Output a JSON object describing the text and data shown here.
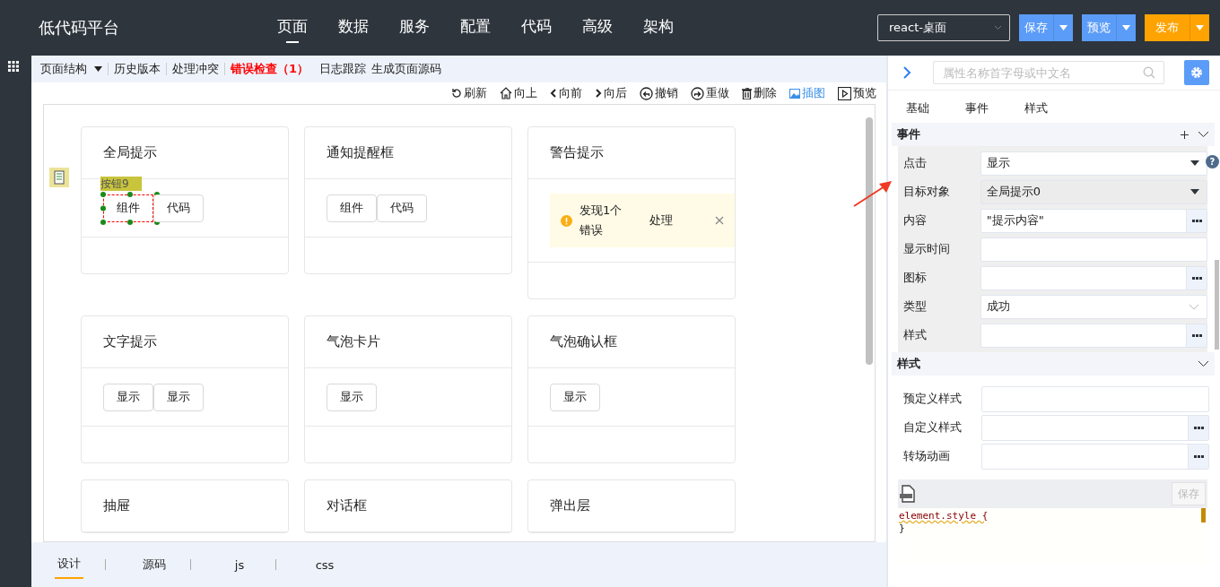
{
  "header": {
    "logo": "低代码平台",
    "nav": [
      {
        "label": "页面",
        "selected": true
      },
      {
        "label": "数据",
        "selected": false
      },
      {
        "label": "服务",
        "selected": false
      },
      {
        "label": "配置",
        "selected": false
      },
      {
        "label": "代码",
        "selected": false
      },
      {
        "label": "高级",
        "selected": false
      },
      {
        "label": "架构",
        "selected": false
      }
    ],
    "env_select": {
      "value": "react-桌面"
    },
    "buttons": [
      {
        "label": "保存",
        "kind": "primary"
      },
      {
        "label": "预览",
        "kind": "primary"
      },
      {
        "label": "发布",
        "kind": "warning"
      }
    ]
  },
  "subtoolbar": [
    {
      "label": "页面结构",
      "kind": "dropdown"
    },
    {
      "label": "历史版本",
      "kind": "plain"
    },
    {
      "label": "处理冲突",
      "kind": "plain"
    },
    {
      "label": "错误检查（1）",
      "kind": "error"
    },
    {
      "label": "日志跟踪",
      "kind": "plain"
    },
    {
      "label": "生成页面源码",
      "kind": "plain"
    }
  ],
  "actions": [
    {
      "label": "刷新",
      "selected": false
    },
    {
      "label": "向上",
      "selected": false
    },
    {
      "label": "向前",
      "selected": false
    },
    {
      "label": "向后",
      "selected": false
    },
    {
      "label": "撤销",
      "selected": false
    },
    {
      "label": "重做",
      "selected": false
    },
    {
      "label": "删除",
      "selected": false
    },
    {
      "label": "插图",
      "selected": true
    },
    {
      "label": "预览",
      "selected": false
    }
  ],
  "cards": [
    {
      "title": "全局提示",
      "kind": "buttons",
      "buttons": [
        {
          "label": "组件",
          "selected": true,
          "tag": "按钮9"
        },
        {
          "label": "代码",
          "selected": false
        }
      ]
    },
    {
      "title": "通知提醒框",
      "kind": "buttons",
      "buttons": [
        {
          "label": "组件",
          "selected": false
        },
        {
          "label": "代码",
          "selected": false
        }
      ]
    },
    {
      "title": "警告提示",
      "kind": "alert",
      "alert": {
        "text": "发现1个错误",
        "action": "处理"
      }
    },
    {
      "title": "文字提示",
      "kind": "buttons",
      "buttons": [
        {
          "label": "显示",
          "selected": false
        },
        {
          "label": "显示",
          "selected": false
        }
      ]
    },
    {
      "title": "气泡卡片",
      "kind": "buttons",
      "buttons": [
        {
          "label": "显示",
          "selected": false
        }
      ]
    },
    {
      "title": "气泡确认框",
      "kind": "buttons",
      "buttons": [
        {
          "label": "显示",
          "selected": false
        }
      ]
    },
    {
      "title": "抽屉",
      "kind": "cut"
    },
    {
      "title": "对话框",
      "kind": "cut"
    },
    {
      "title": "弹出层",
      "kind": "cut"
    }
  ],
  "bottom_tabs": [
    {
      "label": "设计",
      "selected": true
    },
    {
      "label": "源码",
      "selected": false
    },
    {
      "label": "js",
      "selected": false
    },
    {
      "label": "css",
      "selected": false
    }
  ],
  "panel": {
    "search": {
      "placeholder": "属性名称首字母或中文名"
    },
    "tabs": [
      "基础",
      "事件",
      "样式"
    ],
    "sections": [
      {
        "title": "事件",
        "addable": true,
        "boxed": true,
        "rows": [
          {
            "label": "点击",
            "value": "显示",
            "kind": "select",
            "help": "?"
          },
          {
            "label": "目标对象",
            "value": "全局提示0",
            "kind": "select-grey"
          },
          {
            "label": "内容",
            "value": "\"提示内容\"",
            "kind": "more"
          },
          {
            "label": "显示时间",
            "kind": "text"
          },
          {
            "label": "图标",
            "kind": "more"
          },
          {
            "label": "类型",
            "value": "成功",
            "kind": "dropdown"
          },
          {
            "label": "样式",
            "kind": "more"
          }
        ]
      },
      {
        "title": "样式",
        "addable": false,
        "boxed": false,
        "rows": [
          {
            "label": "预定义样式",
            "kind": "text"
          },
          {
            "label": "自定义样式",
            "kind": "more"
          },
          {
            "label": "转场动画",
            "kind": "more"
          }
        ]
      }
    ],
    "editor": {
      "save": "保存",
      "lines": [
        "element.style {",
        "}"
      ]
    }
  }
}
